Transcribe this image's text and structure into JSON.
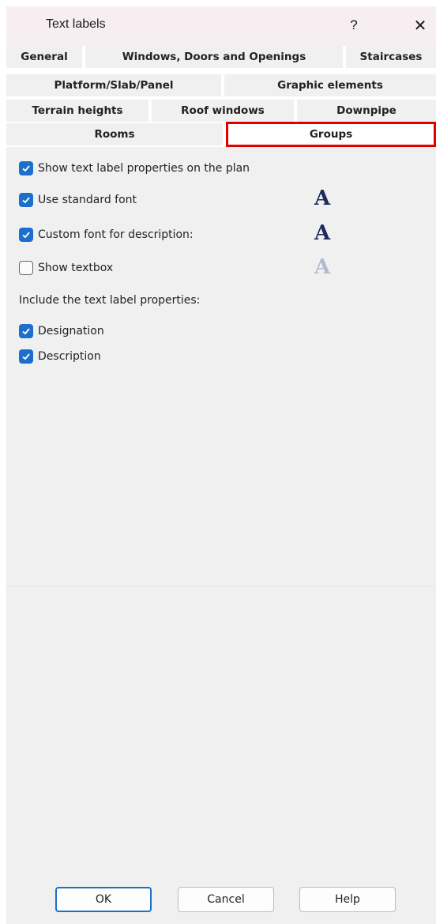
{
  "window": {
    "title": "Text labels",
    "help_glyph": "?",
    "close_glyph": "✕"
  },
  "tabs": {
    "row1": [
      "General",
      "Windows, Doors and Openings",
      "Staircases"
    ],
    "row2": [
      "Platform/Slab/Panel",
      "Graphic elements"
    ],
    "row3": [
      "Terrain heights",
      "Roof windows",
      "Downpipe"
    ],
    "row4": [
      "Rooms",
      "Groups"
    ],
    "active": "Groups",
    "highlight_color": "#e00000"
  },
  "options": {
    "show_properties": {
      "label": "Show text label properties on the plan",
      "checked": true
    },
    "standard_font": {
      "label": "Use standard font",
      "checked": true
    },
    "custom_font": {
      "label": "Custom font for description:",
      "checked": true
    },
    "show_textbox": {
      "label": "Show textbox",
      "checked": false
    },
    "include_label": "Include the text label properties:",
    "designation": {
      "label": "Designation",
      "checked": true
    },
    "description": {
      "label": "Description",
      "checked": true
    },
    "font_glyph": "A"
  },
  "buttons": {
    "ok": "OK",
    "cancel": "Cancel",
    "help": "Help"
  },
  "colors": {
    "accent": "#1c6fcd",
    "title_bar": "#f6eef1",
    "panel": "#f0f0f0"
  }
}
